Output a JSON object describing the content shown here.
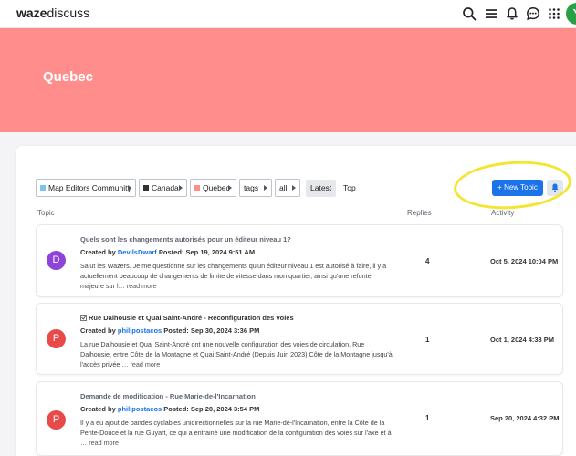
{
  "header": {
    "logo_brand": "waze",
    "logo_product": "discuss",
    "avatar_letter": "Y"
  },
  "banner": {
    "title": "Quebec"
  },
  "breadcrumbs": [
    {
      "label": "Map Editors Community",
      "color": "#7dc4ea"
    },
    {
      "label": "Canada",
      "color": "#333333"
    },
    {
      "label": "Quebec",
      "color": "#ff8d8b"
    },
    {
      "label": "tags"
    },
    {
      "label": "all"
    }
  ],
  "nav": {
    "latest": "Latest",
    "top": "Top",
    "active": "Latest"
  },
  "actions": {
    "new_topic": "+ New Topic",
    "notifications_icon": "bell-icon"
  },
  "columns": {
    "topic": "Topic",
    "replies": "Replies",
    "activity": "Activity"
  },
  "topics": [
    {
      "title": "Quels sont les changements autorisés pour un éditeur niveau 1?",
      "created_by": "Created by",
      "username": "DevilsDwarf",
      "posted": "Posted: Sep 19, 2024 9:51 AM",
      "excerpt": "Salut les Wazers. Je me questionne sur les changements qu'un éditeur niveau 1 est autorisé à faire, il y a actuellement beaucoup de changements de limite de vitesse dans mon quartier, ainsi qu'une refonte majeure sur l…",
      "read_more": "read more",
      "avatar_letter": "D",
      "avatar_color": "#8e44d8",
      "replies": "4",
      "activity": "Oct 5, 2024 10:04 PM"
    },
    {
      "title": "Rue Dalhousie et Quai Saint-André - Reconfiguration des voies",
      "created_by": "Created by",
      "username": "philipostacos",
      "posted": "Posted: Sep 30, 2024 3:36 PM",
      "excerpt": "La rue Dalhousie et Quai Saint-André ont une nouvelle configuration des voies de circulation. Rue Dalhousie, entre Côte de la Montagne et Quai Saint-André (Depuis Juin 2023) Côte de la Montagne jusqu'à l'accès privée …",
      "read_more": "read more",
      "avatar_letter": "P",
      "avatar_color": "#e84a4a",
      "solved": true,
      "replies": "1",
      "activity": "Oct 1, 2024 4:33 PM"
    },
    {
      "title": "Demande de modification - Rue Marie-de-l'Incarnation",
      "created_by": "Created by",
      "username": "philipostacos",
      "posted": "Posted: Sep 20, 2024 3:54 PM",
      "excerpt": "Il y a eu ajout de bandes cyclables unidirectionnelles sur la rue Marie-de-l'Incarnation, entre la Côte de la Pente-Douce et la rue Guyart, ce qui a entrainé une modification de la configuration des voies sur l'axe et à …",
      "read_more": "read more",
      "avatar_letter": "P",
      "avatar_color": "#e84a4a",
      "replies": "1",
      "activity": "Sep 20, 2024 4:32 PM"
    }
  ]
}
